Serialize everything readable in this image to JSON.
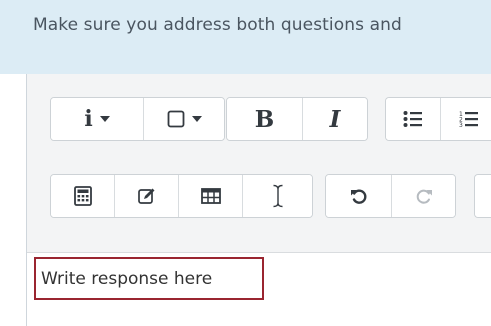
{
  "instruction": {
    "text": "Make sure you address both questions and"
  },
  "editor": {
    "placeholder": "Write response here",
    "toolbar": {
      "row1": [
        {
          "name": "info-style-menu",
          "icon": "info-icon",
          "label": "i"
        },
        {
          "name": "paragraph-style-menu",
          "icon": "square-icon"
        },
        {
          "name": "bold",
          "icon": "bold-icon",
          "label": "B"
        },
        {
          "name": "italic",
          "icon": "italic-icon",
          "label": "I"
        },
        {
          "name": "unordered-list",
          "icon": "bullet-list-icon"
        },
        {
          "name": "ordered-list",
          "icon": "numbered-list-icon"
        }
      ],
      "row2": [
        {
          "name": "equation",
          "icon": "calculator-icon"
        },
        {
          "name": "draw",
          "icon": "edit-pencil-icon"
        },
        {
          "name": "table",
          "icon": "table-icon"
        },
        {
          "name": "text-cursor",
          "icon": "text-cursor-icon"
        },
        {
          "name": "undo",
          "icon": "undo-icon"
        },
        {
          "name": "redo",
          "icon": "redo-icon",
          "disabled": true
        }
      ]
    }
  },
  "colors": {
    "info_panel_bg": "#dcecf5",
    "toolbar_bg": "#f3f4f5",
    "highlight_border": "#9a2530",
    "icon_color": "#343a40",
    "disabled_icon_color": "#b6bbc0"
  }
}
